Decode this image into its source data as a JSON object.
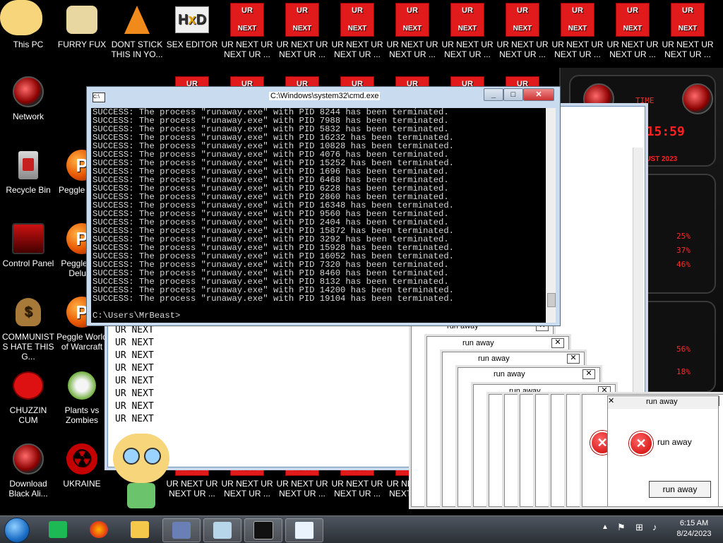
{
  "desktop": {
    "icons": [
      {
        "label": "This PC"
      },
      {
        "label": "FURRY FUX"
      },
      {
        "label": "DONT STICK THIS IN YO..."
      },
      {
        "label": "SEX EDITOR"
      },
      {
        "label": "UR NEXT UR NEXT UR ..."
      },
      {
        "label": "Network"
      },
      {
        "label": "Recycle Bin"
      },
      {
        "label": "Peggle De..."
      },
      {
        "label": "Control Panel"
      },
      {
        "label": "Peggle N... Deluxe"
      },
      {
        "label": "COMMUNISTS HATE THIS G..."
      },
      {
        "label": "Peggle World of Warcraft"
      },
      {
        "label": "CHUZZIN CUM"
      },
      {
        "label": "Plants vs Zombies"
      },
      {
        "label": "Download Black Ali..."
      },
      {
        "label": "UKRAINE"
      },
      {
        "label": "UR NEXT UR NEXT UR ..."
      }
    ],
    "ur_tile_top": "UR",
    "ur_tile_bottom": "NEXT",
    "ur_next_label": "UR NEXT UR NEXT UR ...",
    "ur_next_label_short": "UR NEXT UR NEXT UR"
  },
  "alien_widget": {
    "label_time": "TIME",
    "clock": "6:15:59",
    "date": "AUGUST 2023",
    "pct1": "25%",
    "pct2": "37%",
    "pct3": "46%",
    "pct4": "56%",
    "pct5": "18%"
  },
  "cmd": {
    "title": "C:\\Windows\\system32\\cmd.exe",
    "lines": [
      "SUCCESS: The process \"runaway.exe\" with PID 8244 has been terminated.",
      "SUCCESS: The process \"runaway.exe\" with PID 7988 has been terminated.",
      "SUCCESS: The process \"runaway.exe\" with PID 5832 has been terminated.",
      "SUCCESS: The process \"runaway.exe\" with PID 16232 has been terminated.",
      "SUCCESS: The process \"runaway.exe\" with PID 10828 has been terminated.",
      "SUCCESS: The process \"runaway.exe\" with PID 4076 has been terminated.",
      "SUCCESS: The process \"runaway.exe\" with PID 15252 has been terminated.",
      "SUCCESS: The process \"runaway.exe\" with PID 1696 has been terminated.",
      "SUCCESS: The process \"runaway.exe\" with PID 6468 has been terminated.",
      "SUCCESS: The process \"runaway.exe\" with PID 6228 has been terminated.",
      "SUCCESS: The process \"runaway.exe\" with PID 2860 has been terminated.",
      "SUCCESS: The process \"runaway.exe\" with PID 16348 has been terminated.",
      "SUCCESS: The process \"runaway.exe\" with PID 9560 has been terminated.",
      "SUCCESS: The process \"runaway.exe\" with PID 2404 has been terminated.",
      "SUCCESS: The process \"runaway.exe\" with PID 15872 has been terminated.",
      "SUCCESS: The process \"runaway.exe\" with PID 3292 has been terminated.",
      "SUCCESS: The process \"runaway.exe\" with PID 15928 has been terminated.",
      "SUCCESS: The process \"runaway.exe\" with PID 16052 has been terminated.",
      "SUCCESS: The process \"runaway.exe\" with PID 7320 has been terminated.",
      "SUCCESS: The process \"runaway.exe\" with PID 8460 has been terminated.",
      "SUCCESS: The process \"runaway.exe\" with PID 8132 has been terminated.",
      "SUCCESS: The process \"runaway.exe\" with PID 14200 has been terminated.",
      "SUCCESS: The process \"runaway.exe\" with PID 19104 has been terminated."
    ],
    "prompt": "C:\\Users\\MrBeast>"
  },
  "notepad": {
    "lines": [
      "UR  NEXT",
      "UR  NEXT",
      "UR  NEXT",
      "UR  NEXT",
      "UR  NEXT",
      "UR  NEXT",
      "UR  NEXT",
      "UR  NEXT"
    ]
  },
  "popups": {
    "title": "run away",
    "title_short": "run a",
    "message": "run away",
    "button": "run away"
  },
  "taskbar": {
    "time": "6:15 AM",
    "date": "8/24/2023"
  }
}
